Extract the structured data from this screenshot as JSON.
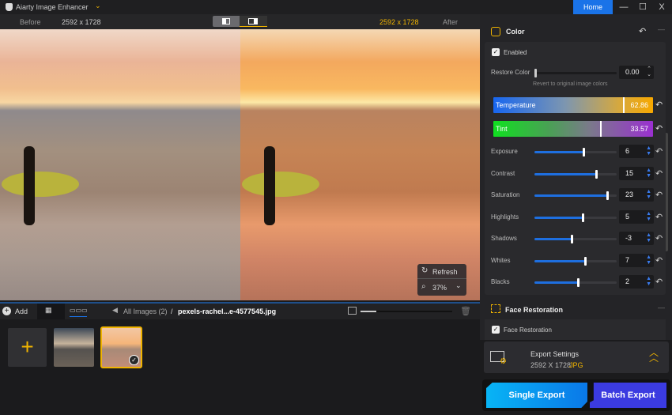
{
  "app": {
    "title": "Aiarty Image Enhancer",
    "home": "Home",
    "minimize": "—",
    "maximize": "☐",
    "close": "X"
  },
  "compare": {
    "before_label": "Before",
    "before_size": "2592 x 1728",
    "after_size": "2592 x 1728",
    "after_label": "After"
  },
  "viewer": {
    "refresh": "Refresh",
    "zoom": "37%"
  },
  "toolbar": {
    "add": "Add",
    "breadcrumb_root": "All Images (2)",
    "separator": "/",
    "filename": "pexels-rachel...e-4577545.jpg",
    "thumb_size_fraction": 0.17
  },
  "thumbnails": [
    {
      "name": "thumbnail-1",
      "selected": false
    },
    {
      "name": "thumbnail-2",
      "selected": true
    }
  ],
  "color": {
    "title": "Color",
    "enabled_label": "Enabled",
    "enabled": true,
    "restore_label": "Restore Color",
    "restore_value": "0.00",
    "restore_hint": "Revert to original image colors",
    "temperature": {
      "label": "Temperature",
      "value": 62.86,
      "display": "62.86",
      "range": [
        -100,
        100
      ]
    },
    "tint": {
      "label": "Tint",
      "value": 33.57,
      "display": "33.57",
      "range": [
        -100,
        100
      ]
    },
    "sliders": [
      {
        "label": "Exposure",
        "value": 6
      },
      {
        "label": "Contrast",
        "value": 15
      },
      {
        "label": "Saturation",
        "value": 23
      },
      {
        "label": "Highlights",
        "value": 5
      },
      {
        "label": "Shadows",
        "value": -3
      },
      {
        "label": "Whites",
        "value": 7
      },
      {
        "label": "Blacks",
        "value": 2
      }
    ],
    "slider_range": [
      -30,
      30
    ]
  },
  "face": {
    "title": "Face Restoration",
    "checkbox_label": "Face Restoration",
    "enabled": true
  },
  "export": {
    "title": "Export Settings",
    "size": "2592 X 1728",
    "format": "JPG",
    "single": "Single Export",
    "batch": "Batch Export"
  },
  "colors": {
    "accent": "#1a73e8",
    "gold": "#f0b400",
    "single_export": "#08a8f0",
    "batch_export": "#3a3ae0"
  }
}
